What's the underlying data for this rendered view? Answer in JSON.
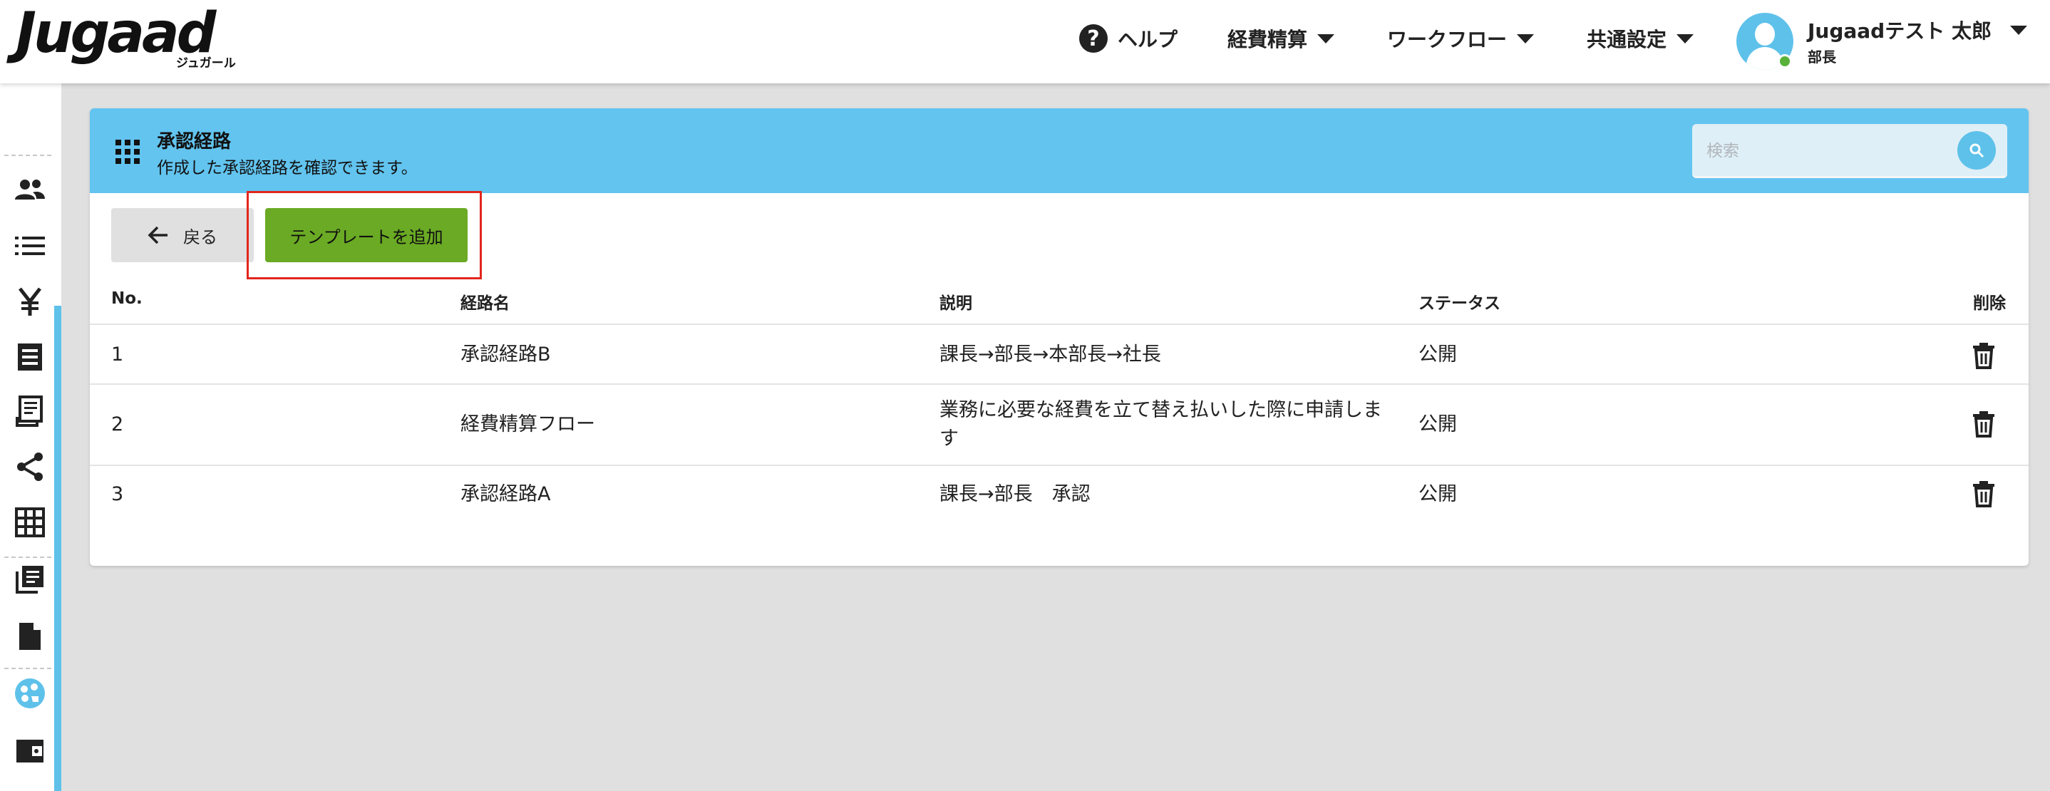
{
  "app": {
    "logo_text": "Jugaad",
    "logo_sub": "ジュガール"
  },
  "nav": {
    "help": "ヘルプ",
    "expense": "経費精算",
    "workflow": "ワークフロー",
    "common": "共通設定"
  },
  "user": {
    "name": "Jugaadテスト 太郎",
    "role": "部長",
    "status_color": "#58b23a"
  },
  "sidebar": {
    "icons": [
      "users-icon",
      "list-icon",
      "yen-icon",
      "receipt-icon",
      "report-icon",
      "share-icon",
      "table-icon",
      "library-icon",
      "document-icon",
      "palette-icon",
      "wallet-icon"
    ],
    "active": "palette-icon"
  },
  "card": {
    "title": "承認経路",
    "subtitle": "作成した承認経路を確認できます。",
    "search_placeholder": "検索"
  },
  "actions": {
    "back_label": "戻る",
    "add_template_label": "テンプレートを追加"
  },
  "table": {
    "headers": {
      "no": "No.",
      "name": "経路名",
      "description": "説明",
      "status": "ステータス",
      "delete": "削除"
    },
    "rows": [
      {
        "no": "1",
        "name": "承認経路B",
        "description": "課長→部長→本部長→社長",
        "status": "公開"
      },
      {
        "no": "2",
        "name": "経費精算フロー",
        "description": "業務に必要な経費を立て替え払いした際に申請します",
        "status": "公開"
      },
      {
        "no": "3",
        "name": "承認経路A",
        "description": "課長→部長　承認",
        "status": "公開"
      }
    ]
  },
  "colors": {
    "header_accent": "#62c4ef",
    "primary_button": "#6aaa24",
    "highlight_border": "#e3261c"
  }
}
